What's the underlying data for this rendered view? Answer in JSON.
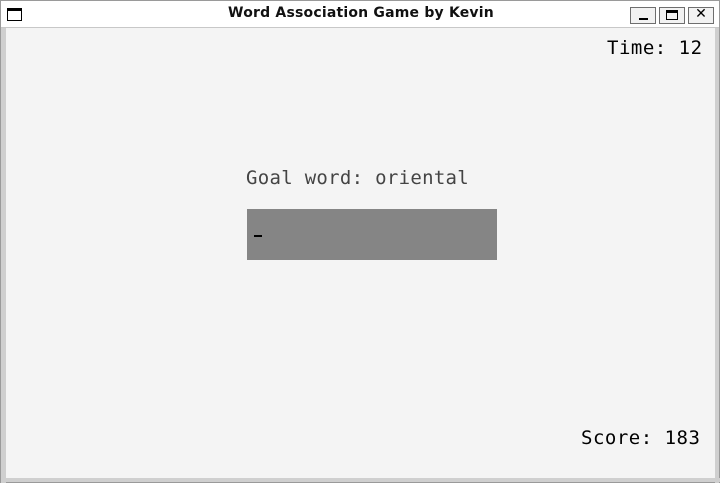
{
  "window": {
    "title": "Word Association Game by Kevin",
    "app_icon": "window-icon",
    "controls": {
      "minimize_icon": "minimize-icon",
      "maximize_icon": "maximize-icon",
      "close_icon": "close-icon",
      "close_glyph": "✕"
    }
  },
  "game": {
    "timer_text": "Time: 12",
    "goal_text": "Goal word: oriental",
    "input_value": "",
    "score_text": "Score: 183"
  },
  "colors": {
    "background": "#f4f4f4",
    "input_box": "#858585",
    "text": "#000000",
    "goal_text": "#444444"
  }
}
